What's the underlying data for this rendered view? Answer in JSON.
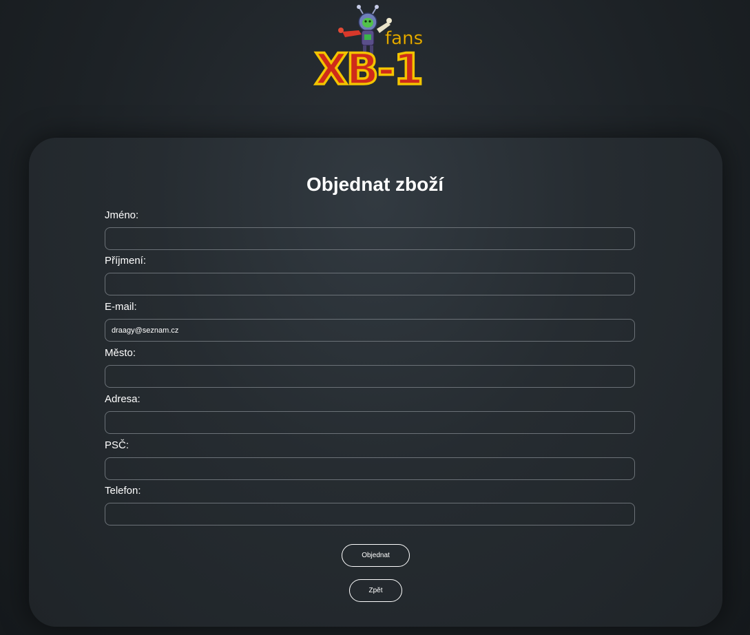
{
  "logo": {
    "brand": "XB-1",
    "sub": "fans"
  },
  "form": {
    "title": "Objednat zboží",
    "fields": [
      {
        "label": "Jméno:",
        "value": ""
      },
      {
        "label": "Příjmení:",
        "value": ""
      },
      {
        "label": "E-mail:",
        "value": "draagy@seznam.cz"
      },
      {
        "label": "Město:",
        "value": ""
      },
      {
        "label": "Adresa:",
        "value": ""
      },
      {
        "label": "PSČ:",
        "value": ""
      },
      {
        "label": "Telefon:",
        "value": ""
      }
    ],
    "submit_label": "Objednat",
    "back_label": "Zpět"
  }
}
